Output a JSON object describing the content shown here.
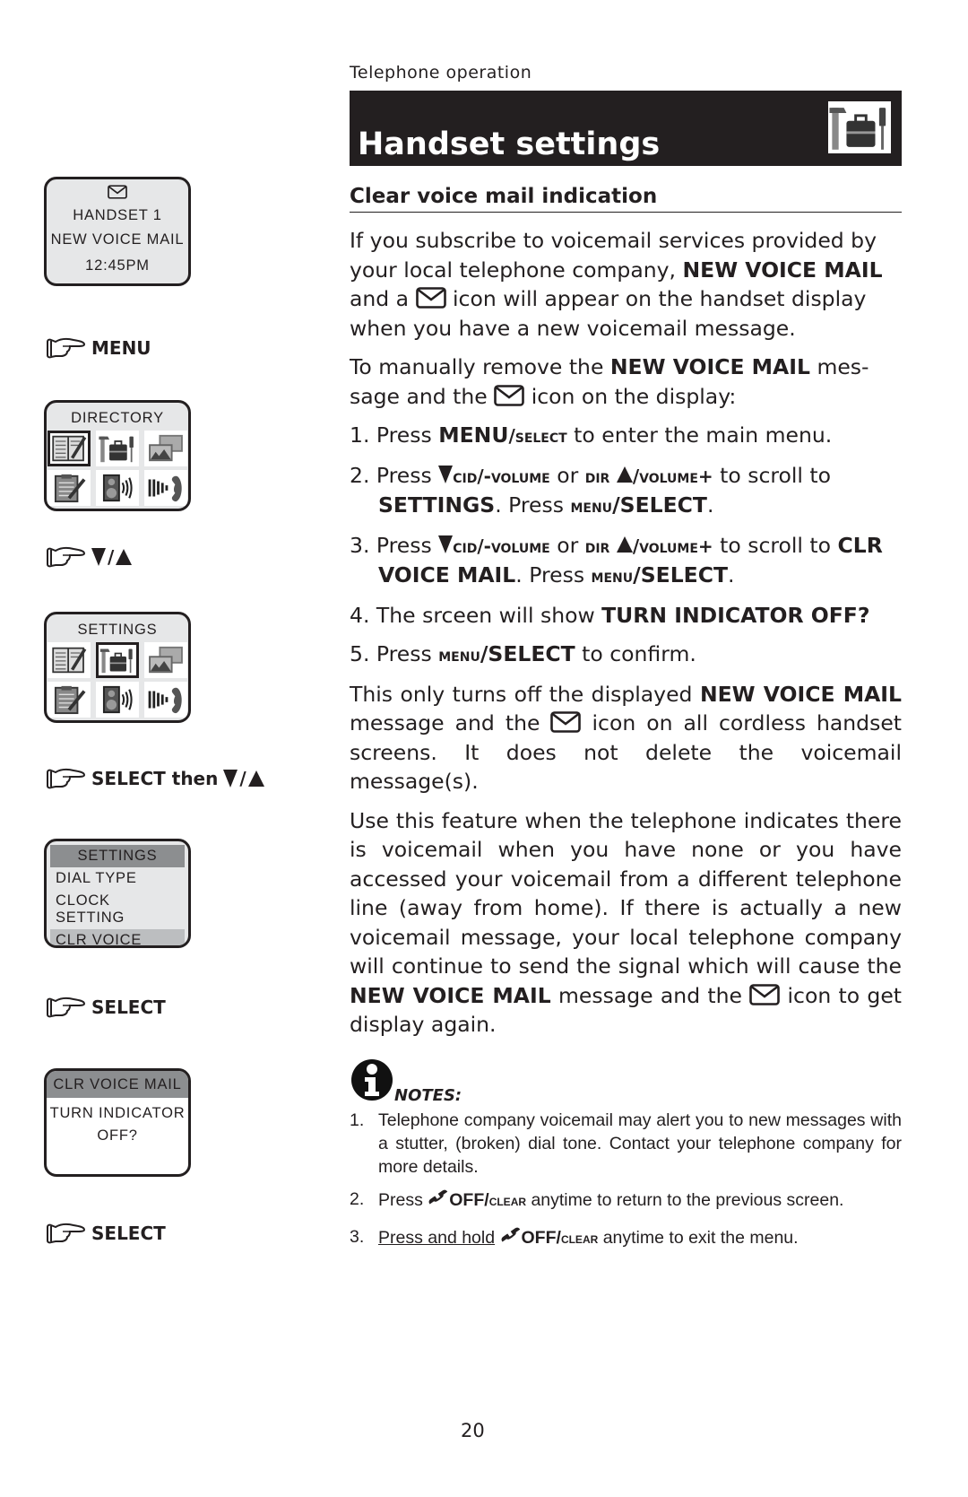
{
  "header": {
    "section": "Telephone operation",
    "title": "Handset settings",
    "title_icon": "settings-tools-icon"
  },
  "subtitle": "Clear voice mail indication",
  "intro": {
    "p1_a": "If you subscribe to voicemail services provided by your local telephone company, ",
    "p1_b": "NEW VOICE MAIL",
    "p1_c": " and a ",
    "p1_d": " icon will appear on the handset display when you have a new voicemail message.",
    "p2_a": "To manually remove the ",
    "p2_b": "NEW VOICE MAIL",
    "p2_c": " mes-sage and the ",
    "p2_d": " icon on the display:"
  },
  "steps": [
    {
      "num": "1. ",
      "a": "Press ",
      "b": "MENU",
      "c": "/select",
      "d": " to enter the main menu."
    },
    {
      "num": "2. ",
      "a": "Press ",
      "b": "cid/-volume",
      "c": " or ",
      "d": "dir",
      "e": "/volume+",
      "f": " to scroll to ",
      "g": "SETTINGS",
      "h": ". Press ",
      "i": "menu",
      "j": "/SELECT",
      "k": "."
    },
    {
      "num": "3. ",
      "a": "Press ",
      "b": "cid/-volume",
      "c": " or ",
      "d": "dir",
      "e": "/volume+",
      "f": " to scroll to ",
      "g": "CLR VOICE MAIL",
      "h": ". Press ",
      "i": "menu",
      "j": "/SELECT",
      "k": "."
    },
    {
      "num": "4. ",
      "a": "The srceen will show ",
      "b": "TURN INDICATOR OFF?"
    },
    {
      "num": "5. ",
      "a": "Press ",
      "b": "menu",
      "c": "/SELECT",
      "d": " to confirm."
    }
  ],
  "after": {
    "p3_a": "This only turns off the displayed ",
    "p3_b": "NEW VOICE MAIL",
    "p3_c": " message and the ",
    "p3_d": " icon on all cordless handset screens. It does not delete the voicemail message(s).",
    "p4_a": "Use this feature when the telephone indicates there is voicemail when you have none or you have accessed your voicemail from a different telephone line (away from home). If there is actually a new voicemail message, your local telephone company will continue to send the signal which will cause the ",
    "p4_b": "NEW VOICE MAIL",
    "p4_c": " message and the ",
    "p4_d": " icon to get display again."
  },
  "notes": {
    "title": "NOTES:",
    "items": [
      {
        "num": "1.",
        "text": "Telephone company voicemail may alert you to new messages with a stutter, (broken) dial tone. Contact your telephone company for more details."
      },
      {
        "num": "2.",
        "a": "Press ",
        "b": "OFF/",
        "c": "clear",
        "d": " anytime to return to the previous screen."
      },
      {
        "num": "3.",
        "u": "Press and hold",
        "b": "OFF/",
        "c": "clear",
        "d": " anytime to exit the menu."
      }
    ]
  },
  "sidebar": {
    "screen1": {
      "line1": "HANDSET 1",
      "line2": "NEW VOICE MAIL",
      "line3": "12:45PM"
    },
    "hint1": "MENU",
    "screen2": {
      "title": "DIRECTORY",
      "selected_index": 0
    },
    "hint2": "/",
    "screen3": {
      "title": "SETTINGS",
      "selected_index": 1
    },
    "hint3": "SELECT then ",
    "hint3_sep": "/",
    "screen4": {
      "title": "SETTINGS",
      "items": [
        "DIAL TYPE",
        "CLOCK SETTING",
        "CLR VOICE MAIL"
      ],
      "highlighted": "CLR VOICE MAIL"
    },
    "hint4": "SELECT",
    "screen5": {
      "title": "CLR VOICE MAIL",
      "line1": "TURN INDICATOR",
      "line2": "OFF?"
    },
    "hint5": "SELECT"
  },
  "page_number": "20"
}
